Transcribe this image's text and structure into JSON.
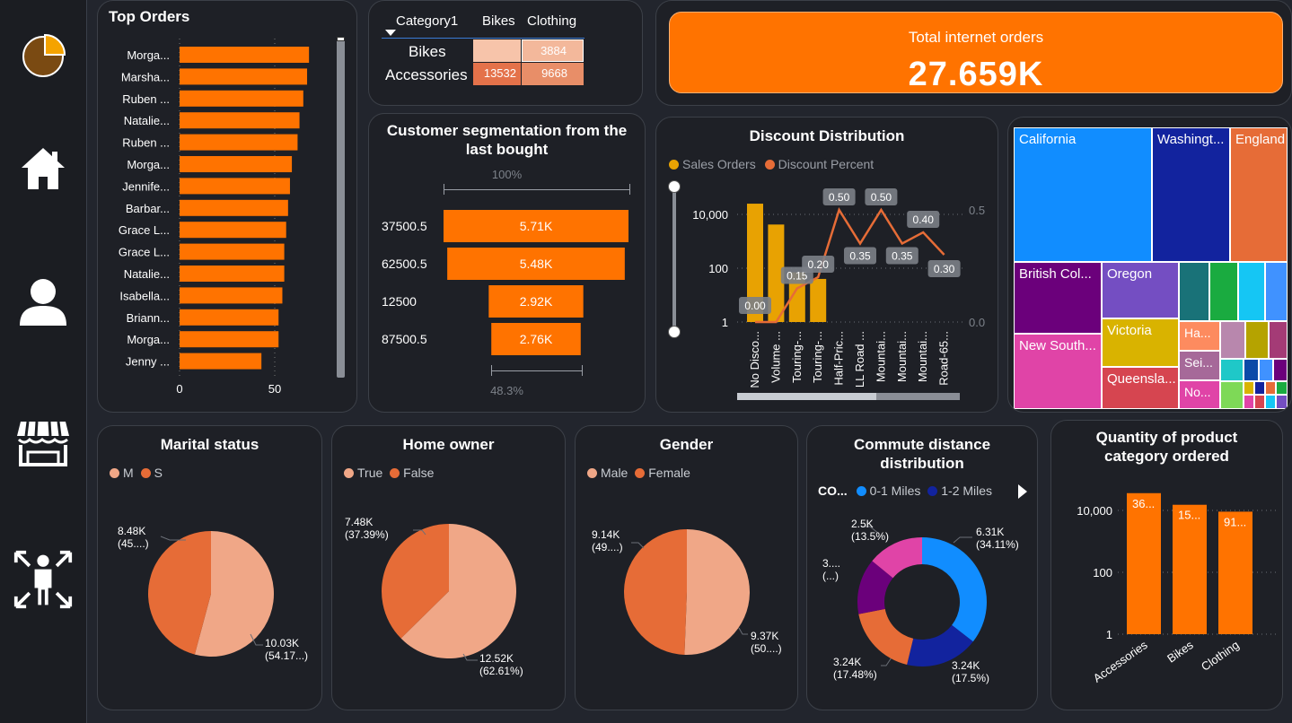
{
  "sidebar": {
    "items": [
      {
        "name": "pie-chart-icon"
      },
      {
        "name": "home-icon"
      },
      {
        "name": "user-icon"
      },
      {
        "name": "store-icon"
      },
      {
        "name": "customers-icon"
      }
    ]
  },
  "top_orders": {
    "title": "Top Orders",
    "names": [
      "Morga...",
      "Marsha...",
      "Ruben ...",
      "Natalie...",
      "Ruben ...",
      "Morga...",
      "Jennife...",
      "Barbar...",
      "Grace L...",
      "Grace L...",
      "Natalie...",
      "Isabella...",
      "Briann...",
      "Morga...",
      "Jenny ..."
    ],
    "values": [
      68,
      67,
      65,
      63,
      62,
      59,
      58,
      57,
      56,
      55,
      55,
      54,
      52,
      52,
      43
    ],
    "ticks": [
      "0",
      "50"
    ],
    "color": "#ff7300"
  },
  "matrix": {
    "header": [
      "Category1",
      "Bikes",
      "Clothing"
    ],
    "rows": [
      {
        "label": "Bikes",
        "bikes": "",
        "clothing": "3884"
      },
      {
        "label": "Accessories",
        "bikes": "13532",
        "clothing": "9668"
      }
    ]
  },
  "kpi": {
    "label": "Total internet orders",
    "value": "27.659K",
    "color": "#ff7300"
  },
  "funnel": {
    "title": "Customer segmentation from the last bought",
    "top_pct": "100%",
    "bottom_pct": "48.3%",
    "categories": [
      "37500.5",
      "62500.5",
      "12500",
      "87500.5"
    ],
    "values": [
      5.71,
      5.48,
      2.92,
      2.76
    ],
    "labels": [
      "5.71K",
      "5.48K",
      "2.92K",
      "2.76K"
    ]
  },
  "discount": {
    "title": "Discount Distribution",
    "legend": [
      "Sales Orders",
      "Discount Percent"
    ],
    "y_ticks": [
      "10,000",
      "100",
      "1"
    ],
    "y2_ticks": [
      "0.5",
      "0.0"
    ],
    "categories": [
      "No Disco...",
      "Volume ...",
      "Touring-...",
      "Touring-...",
      "Half-Pric...",
      "LL Road ...",
      "Mountai...",
      "Mountai...",
      "Mountai...",
      "Road-65..."
    ],
    "orders": [
      25000,
      4200,
      70,
      40,
      null,
      null,
      null,
      null,
      null,
      null
    ],
    "percent": [
      0.0,
      0.0,
      0.15,
      0.2,
      0.5,
      0.35,
      0.5,
      0.35,
      0.4,
      0.3
    ],
    "percent_labels": [
      "0.00",
      "",
      "0.15",
      "0.20",
      "0.50",
      "0.35",
      "0.50",
      "0.35",
      "0.40",
      "0.30"
    ]
  },
  "treemap": {
    "cells": [
      {
        "label": "California",
        "color": "#118dff"
      },
      {
        "label": "Washingt...",
        "color": "#12239e"
      },
      {
        "label": "England",
        "color": "#e66c37"
      },
      {
        "label": "British Col...",
        "color": "#6b007b"
      },
      {
        "label": "Oregon",
        "color": "#744ec2"
      },
      {
        "label": "Victoria",
        "color": "#d9b300"
      },
      {
        "label": "New South...",
        "color": "#e044a7"
      },
      {
        "label": "Queensla...",
        "color": "#d64550"
      },
      {
        "label": "Ha...",
        "color": "#fd8b5f"
      },
      {
        "label": "Sei...",
        "color": "#a66999"
      },
      {
        "label": "No...",
        "color": "#e044a7"
      }
    ]
  },
  "marital": {
    "title": "Marital status",
    "legend": [
      "M",
      "S"
    ],
    "values": [
      45.83,
      54.17
    ],
    "labels": [
      [
        "8.48K",
        "(45....)"
      ],
      [
        "10.03K",
        "(54.17...)"
      ]
    ],
    "colors": [
      "#e66c37",
      "#f0a787"
    ]
  },
  "home_owner": {
    "title": "Home owner",
    "legend": [
      "True",
      "False"
    ],
    "values": [
      62.61,
      37.39
    ],
    "labels": [
      [
        "12.52K",
        "(62.61%)"
      ],
      [
        "7.48K",
        "(37.39%)"
      ]
    ],
    "colors": [
      "#f0a787",
      "#e66c37"
    ]
  },
  "gender": {
    "title": "Gender",
    "legend": [
      "Male",
      "Female"
    ],
    "values": [
      50.6,
      49.4
    ],
    "labels": [
      [
        "9.37K",
        "(50....)"
      ],
      [
        "9.14K",
        "(49....)"
      ]
    ],
    "colors": [
      "#f0a787",
      "#e66c37"
    ]
  },
  "commute": {
    "title": "Commute distance distribution",
    "legend_title": "CO...",
    "legend": [
      "0-1 Miles",
      "1-2 Miles"
    ],
    "values": [
      34.11,
      17.5,
      17.48,
      13.4,
      13.5
    ],
    "colors": [
      "#118dff",
      "#12239e",
      "#e66c37",
      "#6b007b",
      "#e044a7"
    ],
    "labels": [
      [
        "6.31K",
        "(34.11%)"
      ],
      [
        "3.24K",
        "(17.5%)"
      ],
      [
        "3.24K",
        "(17.48%)"
      ],
      [
        "3....",
        "(...)"
      ],
      [
        "2.5K",
        "(13.5%)"
      ]
    ]
  },
  "qty": {
    "title": "Quantity of product category ordered",
    "y_ticks": [
      "10,000",
      "100",
      "1"
    ],
    "categories": [
      "Accessories",
      "Bikes",
      "Clothing"
    ],
    "values": [
      36092,
      15205,
      9101
    ],
    "labels": [
      "36...",
      "15...",
      "91..."
    ]
  }
}
